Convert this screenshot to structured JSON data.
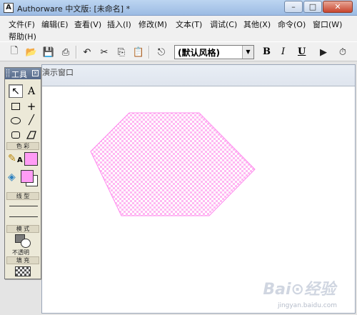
{
  "window": {
    "icon_glyph": "A",
    "title": "Authorware 中文版: [未命名] *",
    "minimize_glyph": "–",
    "maximize_glyph": "□",
    "close_glyph": "✕"
  },
  "menu": {
    "file": "文件(F)",
    "edit": "编辑(E)",
    "view": "查看(V)",
    "insert": "插入(I)",
    "modify": "修改(M)",
    "text": "文本(T)",
    "debug": "调试(C)",
    "other": "其他(X)",
    "command": "命令(O)",
    "window": "窗口(W)",
    "help": "帮助(H)"
  },
  "toolbar": {
    "new_glyph": "🗋",
    "open_glyph": "📂",
    "save_all_glyph": "💾",
    "import_glyph": "⎙",
    "undo_glyph": "↶",
    "cut_glyph": "✂",
    "copy_glyph": "⎘",
    "paste_glyph": "📋",
    "find_glyph": "⎋",
    "style_value": "(默认风格)",
    "style_arrow": "▼",
    "bold": "B",
    "italic": "I",
    "underline": "U",
    "run_glyph": "▶",
    "control_glyph": "⏱"
  },
  "document": {
    "title": "演示窗口"
  },
  "tool_palette": {
    "title": "工具",
    "close_glyph": "x",
    "color_section": "色 彩",
    "line_section": "线 型",
    "mode_section": "模 式",
    "mode_value": "不透明",
    "fill_section": "填 充",
    "pointer_glyph": "↖",
    "text_glyph": "A",
    "crosshair_glyph": "+",
    "line_glyph": "╱",
    "pencil_glyph": "✎",
    "fill_bucket_glyph": "◈",
    "pen_text_glyph": "A"
  },
  "colors": {
    "fill_pink": "#ff9cf5",
    "shape_fill": "#ffb9f2",
    "shape_check": "#ffffff",
    "shape_stroke": "#ff88ee"
  },
  "watermark": {
    "brand": "Bai⊙经验",
    "url": "jingyan.baidu.com"
  }
}
